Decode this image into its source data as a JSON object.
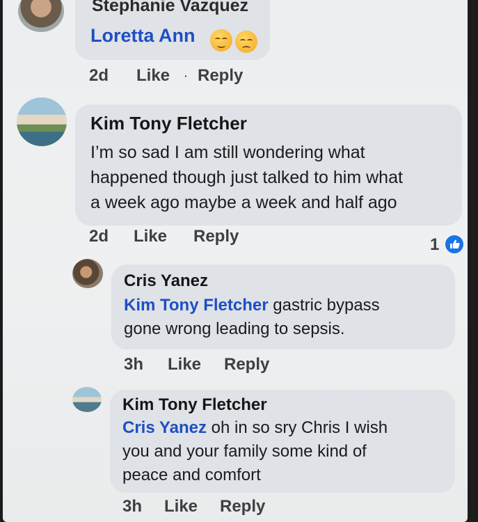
{
  "comments": [
    {
      "author": "Stephanie Vazquez",
      "mention": "Loretta Ann",
      "body": "",
      "emoji": [
        "grimace-emoji",
        "sad-emoji"
      ],
      "time": "2d",
      "like": "Like",
      "reply": "Reply"
    },
    {
      "author": "Kim Tony Fletcher",
      "mention": "",
      "body_lines": [
        "I’m so sad I am still wondering what",
        "happened though just talked to him what",
        "a week ago maybe a week and half ago"
      ],
      "time": "2d",
      "like": "Like",
      "reply": "Reply",
      "reaction_count": "1",
      "reaction_icon": "thumbs-up-icon"
    },
    {
      "author": "Cris Yanez",
      "mention": "Kim Tony Fletcher",
      "body_first": " gastric bypass",
      "body_rest": "gone wrong leading to sepsis.",
      "time": "3h",
      "like": "Like",
      "reply": "Reply"
    },
    {
      "author": "Kim Tony Fletcher",
      "mention": "Cris Yanez",
      "body_first": " oh in so sry Chris I wish",
      "body_lines": [
        "you and your family some kind of",
        "peace and comfort"
      ],
      "time": "3h",
      "like": "Like",
      "reply": "Reply"
    }
  ],
  "colors": {
    "mention": "#1d4fc4",
    "bubble": "#dfe2e6",
    "like_badge": "#1b74e4"
  }
}
